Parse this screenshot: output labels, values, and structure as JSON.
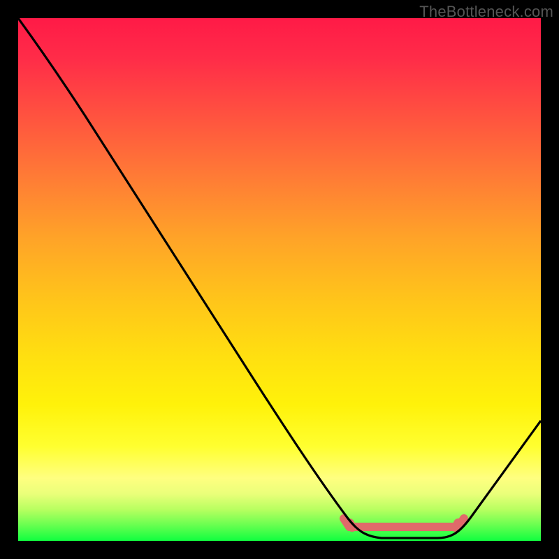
{
  "watermark": "TheBottleneck.com",
  "chart_data": {
    "type": "line",
    "title": "",
    "xlabel": "",
    "ylabel": "",
    "xlim": [
      0,
      100
    ],
    "ylim": [
      0,
      100
    ],
    "series": [
      {
        "name": "curve",
        "points": [
          {
            "x": 0,
            "y": 100
          },
          {
            "x": 6,
            "y": 93
          },
          {
            "x": 12,
            "y": 85
          },
          {
            "x": 18,
            "y": 75
          },
          {
            "x": 28,
            "y": 58
          },
          {
            "x": 40,
            "y": 39
          },
          {
            "x": 50,
            "y": 23
          },
          {
            "x": 58,
            "y": 11
          },
          {
            "x": 64,
            "y": 3
          },
          {
            "x": 68,
            "y": 0
          },
          {
            "x": 82,
            "y": 0
          },
          {
            "x": 86,
            "y": 3
          },
          {
            "x": 100,
            "y": 23
          }
        ]
      }
    ],
    "highlight": {
      "color": "#e06a6a",
      "x_range": [
        63,
        85
      ],
      "description": "flat-minimum-region marker with round endpoints"
    },
    "gradient_background": {
      "top": "#ff1a47",
      "middle": "#ffe010",
      "bottom": "#10ff40"
    }
  }
}
